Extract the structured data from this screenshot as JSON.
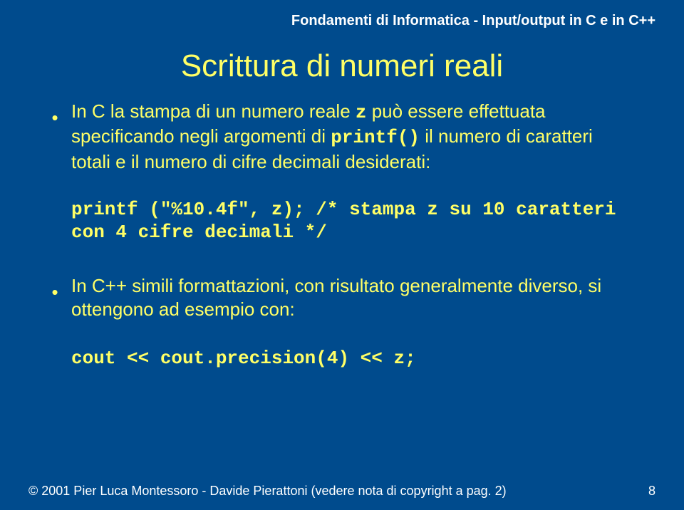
{
  "header": "Fondamenti di Informatica - Input/output in C e in C++",
  "title": "Scrittura di numeri reali",
  "bullet1_pre": "In C la stampa di un numero reale ",
  "bullet1_z": "z",
  "bullet1_mid": " può essere effettuata specificando negli argomenti di ",
  "bullet1_fn": "printf()",
  "bullet1_post": " il numero di caratteri totali e il numero di cifre decimali desiderati:",
  "code1_a": "printf (\"%10.4f\", z); ",
  "code1_b": "/* stampa z su 10 caratteri con 4 cifre decimali */",
  "bullet2": "In C++ simili formattazioni, con risultato generalmente diverso, si ottengono ad esempio con:",
  "code2": "cout << cout.precision(4) << z;",
  "footer_left": "© 2001  Pier Luca Montessoro - Davide Pierattoni (vedere nota di copyright a pag. 2)",
  "footer_right": "8",
  "chart_data": {
    "type": "table",
    "slide_number": 8,
    "deck_title": "Fondamenti di Informatica - Input/output in C e in C++",
    "slide_title": "Scrittura di numeri reali",
    "c_printf_example": {
      "code": "printf (\"%10.4f\", z);",
      "total_width": 10,
      "decimal_digits": 4,
      "variable": "z",
      "comment": "stampa z su 10 caratteri con 4 cifre decimali"
    },
    "cpp_cout_example": {
      "code": "cout << cout.precision(4) << z;",
      "precision": 4,
      "variable": "z"
    },
    "copyright_year": 2001,
    "authors": [
      "Pier Luca Montessoro",
      "Davide Pierattoni"
    ]
  }
}
